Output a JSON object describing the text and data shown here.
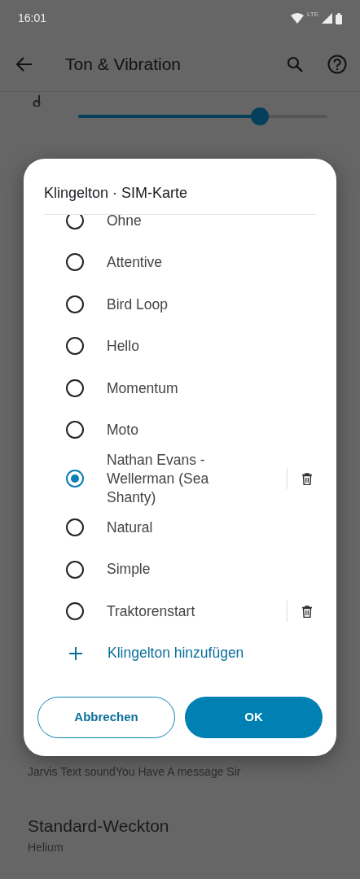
{
  "status_bar": {
    "time": "16:01",
    "network": "LTE"
  },
  "app_bar": {
    "title": "Ton & Vibration"
  },
  "volume_slider": {
    "level": 0.73
  },
  "background_items": [
    {
      "subtitle": "Jarvis Text soundYou Have A message Sir"
    },
    {
      "title": "Standard-Weckton",
      "subtitle": "Helium"
    }
  ],
  "dialog": {
    "title": "Klingelton · SIM-Karte",
    "options": [
      {
        "label": "Ohne",
        "selected": false,
        "deletable": false
      },
      {
        "label": "Attentive",
        "selected": false,
        "deletable": false
      },
      {
        "label": "Bird Loop",
        "selected": false,
        "deletable": false
      },
      {
        "label": "Hello",
        "selected": false,
        "deletable": false
      },
      {
        "label": "Momentum",
        "selected": false,
        "deletable": false
      },
      {
        "label": "Moto",
        "selected": false,
        "deletable": false
      },
      {
        "label": "Nathan Evans - Wellerman (Sea Shanty)",
        "selected": true,
        "deletable": true
      },
      {
        "label": "Natural",
        "selected": false,
        "deletable": false
      },
      {
        "label": "Simple",
        "selected": false,
        "deletable": false
      },
      {
        "label": "Traktorenstart",
        "selected": false,
        "deletable": true
      }
    ],
    "add_label": "Klingelton hinzufügen",
    "buttons": [
      {
        "label": "Abbrechen",
        "kind": "outline"
      },
      {
        "label": "OK",
        "kind": "filled"
      }
    ]
  }
}
